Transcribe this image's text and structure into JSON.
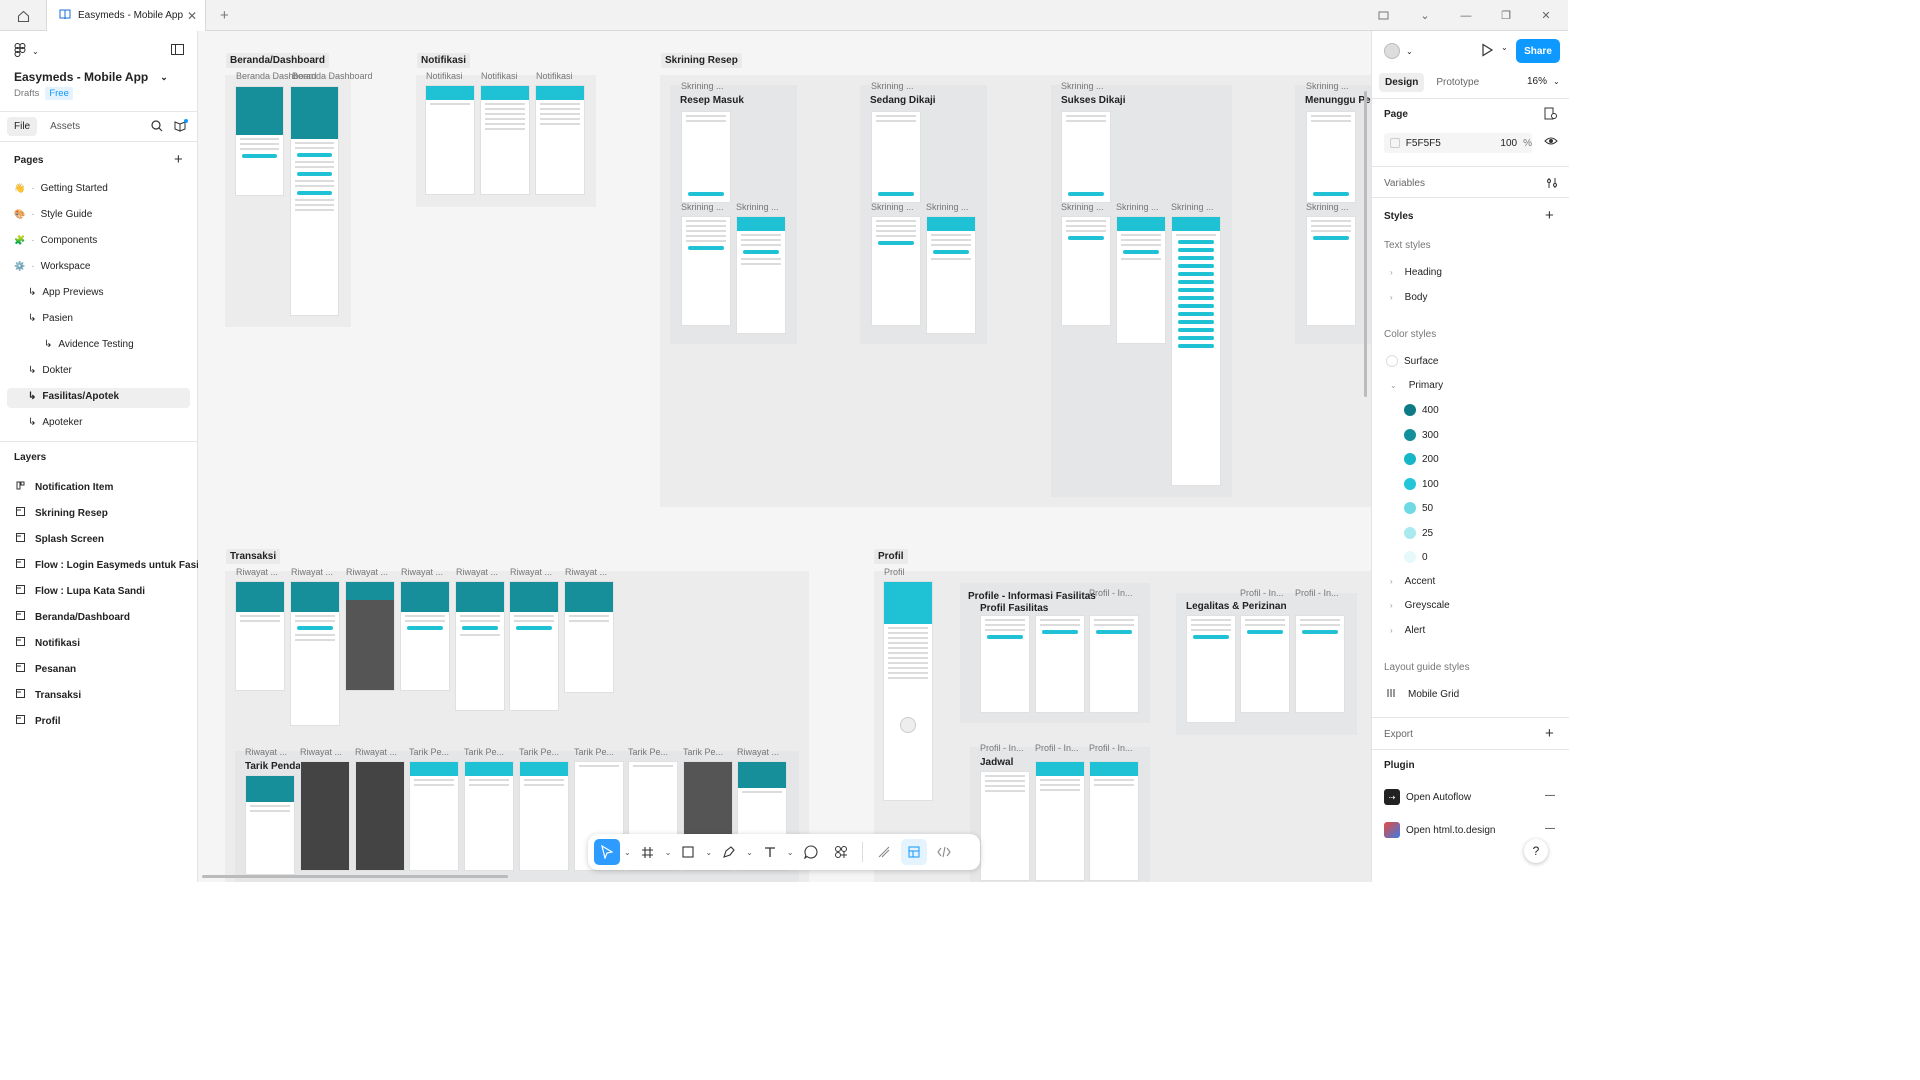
{
  "tabbar": {
    "tab_title": "Easymeds - Mobile App"
  },
  "file": {
    "title": "Easymeds - Mobile App",
    "drafts": "Drafts",
    "plan": "Free"
  },
  "left_tabs": {
    "file": "File",
    "assets": "Assets"
  },
  "pages": {
    "heading": "Pages",
    "items": [
      {
        "label": "Getting Started",
        "emoji": "👋"
      },
      {
        "label": "Style Guide",
        "emoji": "🎨"
      },
      {
        "label": "Components",
        "emoji": "🧩"
      },
      {
        "label": "Workspace",
        "emoji": "⚙️"
      },
      {
        "label": "App Previews"
      },
      {
        "label": "Pasien"
      },
      {
        "label": "Avidence Testing"
      },
      {
        "label": "Dokter"
      },
      {
        "label": "Fasilitas/Apotek"
      },
      {
        "label": "Apoteker"
      }
    ]
  },
  "layers": {
    "heading": "Layers",
    "items": [
      "Notification Item",
      "Skrining Resep",
      "Splash Screen",
      "Flow : Login Easymeds untuk Fasilitas",
      "Flow : Lupa Kata Sandi",
      "Beranda/Dashboard",
      "Notifikasi",
      "Pesanan",
      "Transaksi",
      "Profil"
    ]
  },
  "canvas": {
    "sections": {
      "beranda": "Beranda/Dashboard",
      "notifikasi": "Notifikasi",
      "skrining": "Skrining Resep",
      "transaksi": "Transaksi",
      "tarik": "Tarik Pendapatan",
      "profil": "Profil",
      "profil_info": "Profile - Informasi Fasilitas",
      "profil_fasilitas": "Profil Fasilitas",
      "legalitas": "Legalitas & Perizinan",
      "jadwal": "Jadwal",
      "resep_masuk": "Resep Masuk",
      "sedang_dikaji": "Sedang Dikaji",
      "sukses_dikaji": "Sukses Dikaji",
      "menunggu": "Menunggu Pen"
    },
    "frame_labels": {
      "dashboard": "Beranda Dashboard",
      "notifikasi": "Notifikasi",
      "skrining": "Skrining ...",
      "riwayat": "Riwayat ...",
      "tarik": "Tarik Pe...",
      "profil": "Profil",
      "profil_in": "Profil - In..."
    }
  },
  "right": {
    "tabs": {
      "design": "Design",
      "prototype": "Prototype"
    },
    "zoom": "16%",
    "share": "Share",
    "page": {
      "heading": "Page",
      "color": "F5F5F5",
      "opacity": "100",
      "pct": "%"
    },
    "variables": "Variables",
    "styles": "Styles",
    "text_styles": {
      "heading": "Text styles",
      "items": [
        "Heading",
        "Body"
      ]
    },
    "color_styles": {
      "heading": "Color styles",
      "surface": "Surface",
      "primary": "Primary",
      "shades": [
        {
          "label": "400",
          "color": "#0e7a85"
        },
        {
          "label": "300",
          "color": "#118f9b"
        },
        {
          "label": "200",
          "color": "#17b6c7"
        },
        {
          "label": "100",
          "color": "#22c6d8"
        },
        {
          "label": "50",
          "color": "#6fd9e4"
        },
        {
          "label": "25",
          "color": "#a9e9f0"
        },
        {
          "label": "0",
          "color": "#e6f8fa"
        }
      ],
      "others": [
        "Accent",
        "Greyscale",
        "Alert"
      ]
    },
    "layout_guide": {
      "heading": "Layout guide styles",
      "item": "Mobile Grid"
    },
    "export": "Export",
    "plugin": {
      "heading": "Plugin",
      "items": [
        "Open Autoflow",
        "Open html.to.design"
      ]
    }
  },
  "colors": {
    "accent": "#0d99ff",
    "brand": "#1ec2d4",
    "canvas_bg": "#F5F5F5"
  }
}
